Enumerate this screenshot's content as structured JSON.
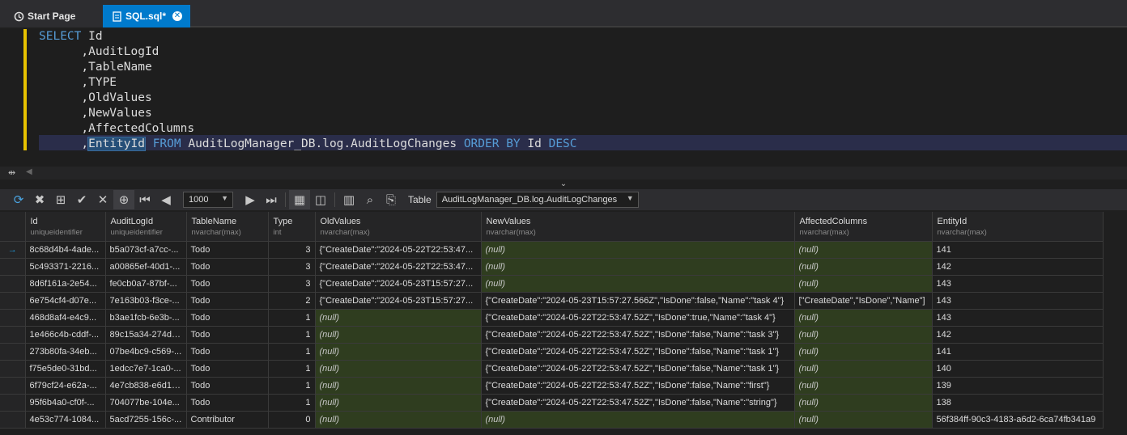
{
  "tabs": [
    {
      "label": "Start Page"
    },
    {
      "label": "SQL.sql*"
    }
  ],
  "editor": {
    "lines": [
      "SELECT Id",
      "      ,AuditLogId",
      "      ,TableName",
      "      ,TYPE",
      "      ,OldValues",
      "      ,NewValues",
      "      ,AffectedColumns"
    ],
    "last_line": {
      "indent": "      ,",
      "column": "EntityId",
      "from_kw": "FROM",
      "table": "AuditLogManager_DB.log.AuditLogChanges",
      "order_kw": "ORDER BY",
      "order_col": "Id",
      "desc_kw": "DESC"
    },
    "keyword_color": "#569cd6"
  },
  "toolbar": {
    "rows_value": "1000",
    "table_label": "Table",
    "table_value": "AuditLogManager_DB.log.AuditLogChanges"
  },
  "grid": {
    "columns": [
      {
        "name": "Id",
        "type": "uniqueidentifier"
      },
      {
        "name": "AuditLogId",
        "type": "uniqueidentifier"
      },
      {
        "name": "TableName",
        "type": "nvarchar(max)"
      },
      {
        "name": "Type",
        "type": "int"
      },
      {
        "name": "OldValues",
        "type": "nvarchar(max)"
      },
      {
        "name": "NewValues",
        "type": "nvarchar(max)"
      },
      {
        "name": "AffectedColumns",
        "type": "nvarchar(max)"
      },
      {
        "name": "EntityId",
        "type": "nvarchar(max)"
      }
    ],
    "null_text": "(null)",
    "current_row_marker": "→",
    "rows": [
      [
        "8c68d4b4-4ade...",
        "b5a073cf-a7cc-...",
        "Todo",
        "3",
        "{\"CreateDate\":\"2024-05-22T22:53:47...",
        null,
        null,
        "141"
      ],
      [
        "5c493371-2216...",
        "a00865ef-40d1-...",
        "Todo",
        "3",
        "{\"CreateDate\":\"2024-05-22T22:53:47...",
        null,
        null,
        "142"
      ],
      [
        "8d6f161a-2e54...",
        "fe0cb0a7-87bf-...",
        "Todo",
        "3",
        "{\"CreateDate\":\"2024-05-23T15:57:27...",
        null,
        null,
        "143"
      ],
      [
        "6e754cf4-d07e...",
        "7e163b03-f3ce-...",
        "Todo",
        "2",
        "{\"CreateDate\":\"2024-05-23T15:57:27...",
        "{\"CreateDate\":\"2024-05-23T15:57:27.566Z\",\"IsDone\":false,\"Name\":\"task 4\"}",
        "[\"CreateDate\",\"IsDone\",\"Name\"]",
        "143"
      ],
      [
        "468d8af4-e4c9...",
        "b3ae1fcb-6e3b-...",
        "Todo",
        "1",
        null,
        "{\"CreateDate\":\"2024-05-22T22:53:47.52Z\",\"IsDone\":true,\"Name\":\"task 4\"}",
        null,
        "143"
      ],
      [
        "1e466c4b-cddf-...",
        "89c15a34-274d-...",
        "Todo",
        "1",
        null,
        "{\"CreateDate\":\"2024-05-22T22:53:47.52Z\",\"IsDone\":false,\"Name\":\"task 3\"}",
        null,
        "142"
      ],
      [
        "273b80fa-34eb...",
        "07be4bc9-c569-...",
        "Todo",
        "1",
        null,
        "{\"CreateDate\":\"2024-05-22T22:53:47.52Z\",\"IsDone\":false,\"Name\":\"task 1\"}",
        null,
        "141"
      ],
      [
        "f75e5de0-31bd...",
        "1edcc7e7-1ca0-...",
        "Todo",
        "1",
        null,
        "{\"CreateDate\":\"2024-05-22T22:53:47.52Z\",\"IsDone\":false,\"Name\":\"task 1\"}",
        null,
        "140"
      ],
      [
        "6f79cf24-e62a-...",
        "4e7cb838-e6d1-...",
        "Todo",
        "1",
        null,
        "{\"CreateDate\":\"2024-05-22T22:53:47.52Z\",\"IsDone\":false,\"Name\":\"first\"}",
        null,
        "139"
      ],
      [
        "95f6b4a0-cf0f-...",
        "704077be-104e...",
        "Todo",
        "1",
        null,
        "{\"CreateDate\":\"2024-05-22T22:53:47.52Z\",\"IsDone\":false,\"Name\":\"string\"}",
        null,
        "138"
      ],
      [
        "4e53c774-1084...",
        "5acd7255-156c-...",
        "Contributor",
        "0",
        null,
        null,
        null,
        "56f384ff-90c3-4183-a6d2-6ca74fb341a9"
      ]
    ]
  },
  "colors": {
    "accent": "#007acc",
    "null_cell": "#2f3d1f",
    "change_bar": "#e8c200"
  }
}
